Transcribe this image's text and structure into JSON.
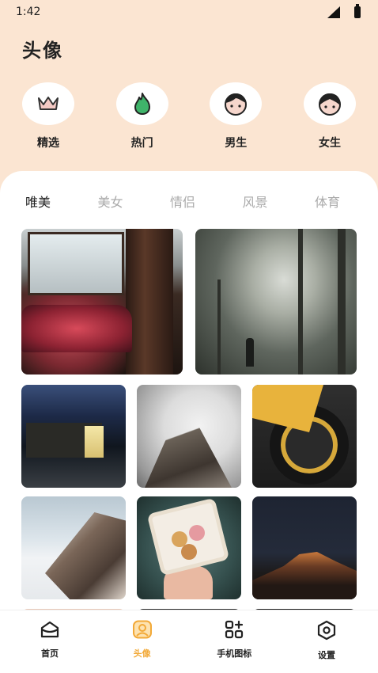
{
  "status": {
    "time": "1:42"
  },
  "header": {
    "title": "头像"
  },
  "categories": [
    {
      "label": "精选",
      "icon": "crown-icon"
    },
    {
      "label": "热门",
      "icon": "flame-icon"
    },
    {
      "label": "男生",
      "icon": "boy-face-icon"
    },
    {
      "label": "女生",
      "icon": "girl-face-icon"
    }
  ],
  "tabs": [
    {
      "label": "唯美",
      "active": true
    },
    {
      "label": "美女",
      "active": false
    },
    {
      "label": "情侣",
      "active": false
    },
    {
      "label": "风景",
      "active": false
    },
    {
      "label": "体育",
      "active": false
    }
  ],
  "nav": [
    {
      "label": "首页",
      "icon": "home-icon",
      "active": false
    },
    {
      "label": "头像",
      "icon": "avatar-icon",
      "active": true
    },
    {
      "label": "手机图标",
      "icon": "apps-grid-icon",
      "active": false
    },
    {
      "label": "设置",
      "icon": "settings-hex-icon",
      "active": false
    }
  ],
  "colors": {
    "accent": "#f5b233",
    "header_bg": "#fbe5d2",
    "nav_active": "#f2a938"
  }
}
